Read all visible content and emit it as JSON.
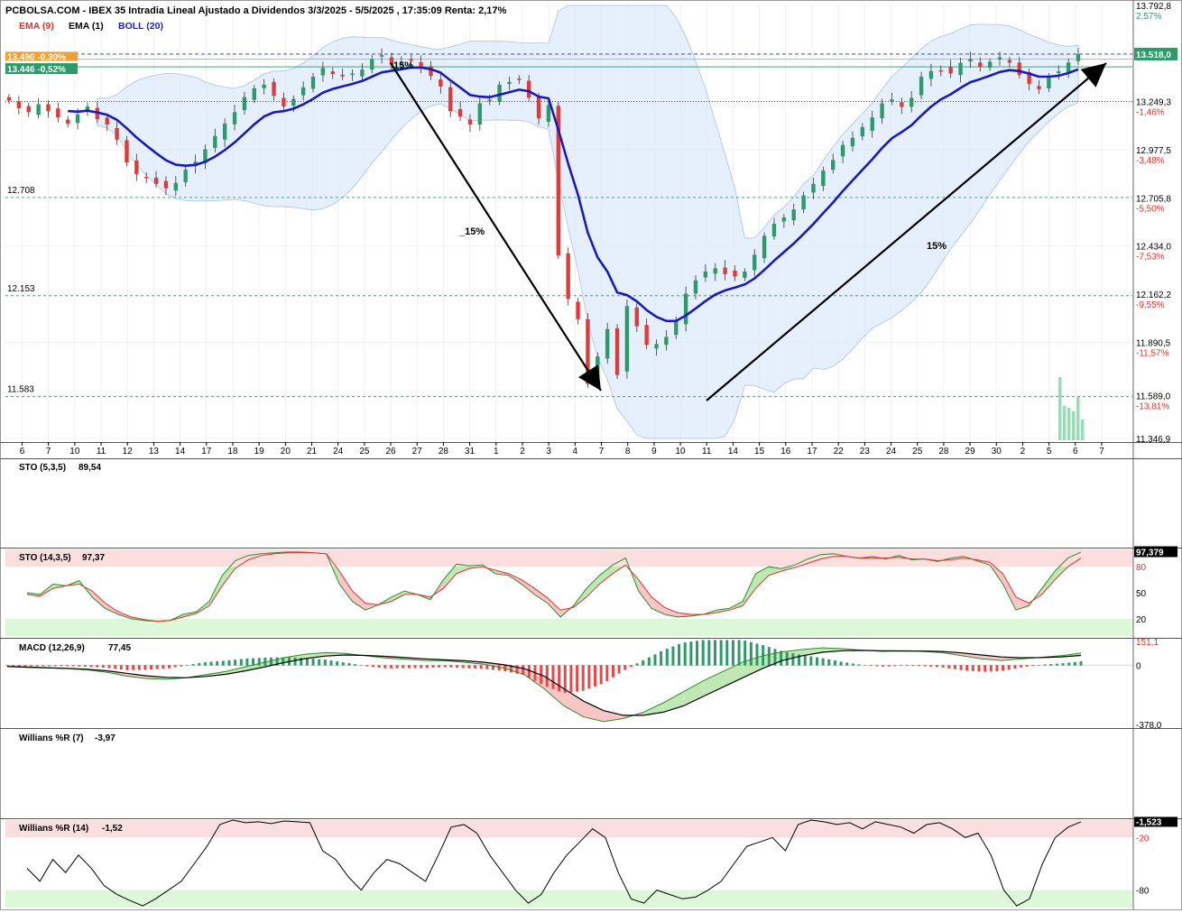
{
  "header": {
    "title": "PCBOLSA.COM - IBEX 35 Intradia Lineal Ajustado a Dividendos 3/3/2025 - 5/5/2025 , 17:35:09 Renta: 2,17%",
    "legend": [
      {
        "label": "EMA (9)",
        "color": "#e03030"
      },
      {
        "label": "EMA (1)",
        "color": "#000000"
      },
      {
        "label": "BOLL (20)",
        "color": "#2020c0"
      }
    ]
  },
  "chart_data": [
    {
      "id": "main",
      "type": "candlestick",
      "title": "IBEX 35 Intradia Lineal Ajustado a Dividendos 3/3/2025 - 5/5/2025",
      "ylim": [
        11346.9,
        13792.8
      ],
      "y_ticks": [
        {
          "value": 13792.8,
          "label": "13.792,8",
          "pct": "2,57%"
        },
        {
          "value": 13249.3,
          "label": "13.249,3",
          "pct": "-1,46%"
        },
        {
          "value": 12977.5,
          "label": "12.977,5",
          "pct": "-3,48%"
        },
        {
          "value": 12705.8,
          "label": "12.705,8",
          "pct": "-5,50%"
        },
        {
          "value": 12434.0,
          "label": "12.434,0",
          "pct": "-7,53%"
        },
        {
          "value": 12162.2,
          "label": "12.162,2",
          "pct": "-9,55%"
        },
        {
          "value": 11890.5,
          "label": "11.890,5",
          "pct": "-11,57%"
        },
        {
          "value": 11589.0,
          "label": "11.589,0",
          "pct": "-13,81%"
        },
        {
          "value": 11346.9,
          "label": "11.346,9",
          "pct": ""
        }
      ],
      "x_ticks": [
        "6",
        "7",
        "10",
        "11",
        "12",
        "13",
        "14",
        "17",
        "18",
        "19",
        "20",
        "21",
        "24",
        "25",
        "26",
        "27",
        "28",
        "31",
        "1",
        "2",
        "3",
        "4",
        "7",
        "8",
        "9",
        "10",
        "11",
        "14",
        "15",
        "16",
        "17",
        "22",
        "23",
        "24",
        "25",
        "28",
        "29",
        "30",
        "2",
        "5",
        "6",
        "7"
      ],
      "levels": [
        {
          "label": "12.708",
          "value": 12708
        },
        {
          "label": "12.153",
          "value": 12153
        },
        {
          "label": "11.583",
          "value": 11583
        }
      ],
      "last_price": {
        "label": "13.518,0",
        "value": 13518
      },
      "price_tags": [
        {
          "label": "13.490 -0,30%",
          "value": 13490,
          "color": "#f0a030"
        },
        {
          "label": "13.446 -0,52%",
          "value": 13446,
          "color": "#2e9a6a"
        }
      ],
      "reference_line": 13249.3,
      "annotations": [
        {
          "text": "15%",
          "x": "26",
          "value": 13510
        },
        {
          "text": "_15%",
          "x": "27-28",
          "value": 12420
        },
        {
          "text": "15%",
          "x": "25",
          "value": 12360
        }
      ],
      "close": [
        13255,
        13212,
        13190,
        13235,
        13195,
        13160,
        13125,
        13178,
        13222,
        13150,
        13120,
        13035,
        12905,
        12840,
        12820,
        12785,
        12760,
        12790,
        12865,
        12910,
        12980,
        13055,
        13125,
        13190,
        13275,
        13325,
        13345,
        13282,
        13222,
        13265,
        13330,
        13390,
        13440,
        13405,
        13392,
        13408,
        13430,
        13488,
        13512,
        13458,
        13468,
        13480,
        13442,
        13395,
        13335,
        13195,
        13165,
        13120,
        13240,
        13260,
        13345,
        13360,
        13375,
        13272,
        13155,
        13230,
        12380,
        12135,
        12020,
        11655,
        11810,
        11965,
        11705,
        12095,
        11980,
        11875,
        11880,
        11920,
        12008,
        12165,
        12240,
        12290,
        12308,
        12275,
        12262,
        12290,
        12385,
        12492,
        12560,
        12595,
        12640,
        12720,
        12785,
        12860,
        12920,
        13005,
        13045,
        13105,
        13160,
        13240,
        13262,
        13220,
        13270,
        13390,
        13422,
        13425,
        13408,
        13468,
        13490,
        13445,
        13475,
        13500,
        13470,
        13400,
        13350,
        13320,
        13390,
        13420,
        13470,
        13518
      ],
      "ema9_sample": [
        13250,
        13215,
        13150,
        12995,
        12870,
        12890,
        13080,
        13245,
        13350,
        13420,
        13460,
        13450,
        13400,
        13360,
        13310,
        13230,
        12980,
        12600,
        12250,
        12110,
        12095,
        12190,
        12330,
        12500,
        12690,
        12860,
        12990,
        13110,
        13200,
        13260,
        13340,
        13360,
        13400,
        13420
      ],
      "bollinger": {
        "upper_max": 13700,
        "lower_min": 11346.9
      }
    },
    {
      "id": "sto_fast",
      "type": "line",
      "title": "STO (5,3,5)",
      "last_value": "89,54",
      "ylim": [
        0,
        100
      ],
      "values": []
    },
    {
      "id": "sto_slow",
      "type": "line",
      "title": "STO (14,3,5)",
      "last_value": "97,37",
      "last_tag": "97,379",
      "ylim": [
        0,
        100
      ],
      "levels": [
        {
          "value": 80,
          "label": "80"
        },
        {
          "value": 50,
          "label": "50"
        },
        {
          "value": 20,
          "label": "20"
        }
      ],
      "k": [
        50,
        48,
        60,
        58,
        64,
        45,
        32,
        25,
        20,
        18,
        17,
        18,
        25,
        28,
        40,
        70,
        87,
        93,
        95,
        96,
        97,
        97,
        96,
        95,
        60,
        40,
        30,
        36,
        45,
        52,
        48,
        42,
        65,
        83,
        81,
        82,
        72,
        70,
        60,
        48,
        38,
        22,
        35,
        55,
        70,
        82,
        90,
        52,
        32,
        25,
        22,
        23,
        25,
        30,
        32,
        40,
        72,
        80,
        78,
        82,
        89,
        94,
        95,
        92,
        90,
        92,
        89,
        93,
        88,
        89,
        86,
        90,
        92,
        87,
        82,
        60,
        30,
        35,
        55,
        75,
        90,
        97
      ],
      "d": [
        48,
        46,
        55,
        58,
        60,
        52,
        38,
        28,
        22,
        19,
        17,
        18,
        22,
        26,
        35,
        58,
        78,
        88,
        93,
        95,
        96,
        96,
        96,
        95,
        75,
        52,
        38,
        36,
        40,
        48,
        48,
        45,
        55,
        72,
        78,
        80,
        76,
        72,
        65,
        55,
        44,
        30,
        33,
        45,
        60,
        72,
        82,
        65,
        45,
        33,
        27,
        25,
        25,
        27,
        30,
        35,
        55,
        70,
        75,
        79,
        84,
        89,
        92,
        92,
        90,
        90,
        90,
        91,
        89,
        89,
        87,
        88,
        90,
        88,
        85,
        72,
        45,
        38,
        48,
        65,
        80,
        90
      ]
    },
    {
      "id": "macd",
      "type": "line",
      "title": "MACD (12,26,9)",
      "last_value": "77,45",
      "ylim": [
        -378.0,
        151.1
      ],
      "y_ticks": [
        {
          "value": 151.1,
          "label": "151,1"
        },
        {
          "value": 0,
          "label": "0"
        },
        {
          "value": -378.0,
          "label": "-378,0"
        }
      ],
      "macd": [
        -10,
        -15,
        -18,
        -22,
        -30,
        -45,
        -70,
        -85,
        -90,
        -80,
        -60,
        -40,
        -10,
        20,
        50,
        70,
        80,
        75,
        60,
        45,
        38,
        30,
        28,
        18,
        5,
        -20,
        -60,
        -150,
        -260,
        -330,
        -360,
        -340,
        -300,
        -240,
        -170,
        -100,
        -40,
        20,
        60,
        85,
        100,
        110,
        105,
        95,
        88,
        90,
        88,
        80,
        60,
        40,
        30,
        40,
        50,
        60,
        77
      ],
      "signal": [
        -8,
        -12,
        -16,
        -20,
        -26,
        -36,
        -52,
        -68,
        -78,
        -80,
        -72,
        -58,
        -36,
        -10,
        18,
        42,
        58,
        65,
        62,
        56,
        48,
        40,
        34,
        28,
        18,
        2,
        -22,
        -70,
        -150,
        -230,
        -290,
        -320,
        -320,
        -300,
        -260,
        -200,
        -140,
        -80,
        -20,
        30,
        60,
        82,
        92,
        94,
        92,
        91,
        90,
        87,
        78,
        65,
        52,
        47,
        48,
        53,
        62
      ]
    },
    {
      "id": "williams7",
      "type": "line",
      "title": "Willians %R (7)",
      "last_value": "-3,97",
      "ylim": [
        -100,
        0
      ],
      "values": []
    },
    {
      "id": "williams14",
      "type": "line",
      "title": "Willians %R (14)",
      "last_value": "-1,52",
      "last_tag": "-1,523",
      "ylim": [
        -100,
        0
      ],
      "levels": [
        {
          "value": -20,
          "label": "-20"
        },
        {
          "value": -80,
          "label": "-80"
        }
      ],
      "values": [
        -55,
        -70,
        -45,
        -60,
        -40,
        -55,
        -75,
        -85,
        -92,
        -98,
        -90,
        -80,
        -70,
        -50,
        -30,
        -5,
        0,
        -3,
        -2,
        -4,
        -1,
        -2,
        -3,
        -35,
        -45,
        -65,
        -80,
        -60,
        -45,
        -50,
        -60,
        -70,
        -40,
        -8,
        -5,
        -15,
        -40,
        -60,
        -80,
        -95,
        -85,
        -60,
        -40,
        -25,
        -10,
        -20,
        -60,
        -90,
        -95,
        -80,
        -85,
        -90,
        -88,
        -80,
        -70,
        -50,
        -30,
        -25,
        -20,
        -35,
        -5,
        0,
        -2,
        -5,
        -3,
        -10,
        -2,
        -5,
        -8,
        -15,
        -5,
        -3,
        -10,
        -20,
        -15,
        -40,
        -80,
        -98,
        -90,
        -50,
        -20,
        -8,
        -2
      ]
    }
  ]
}
